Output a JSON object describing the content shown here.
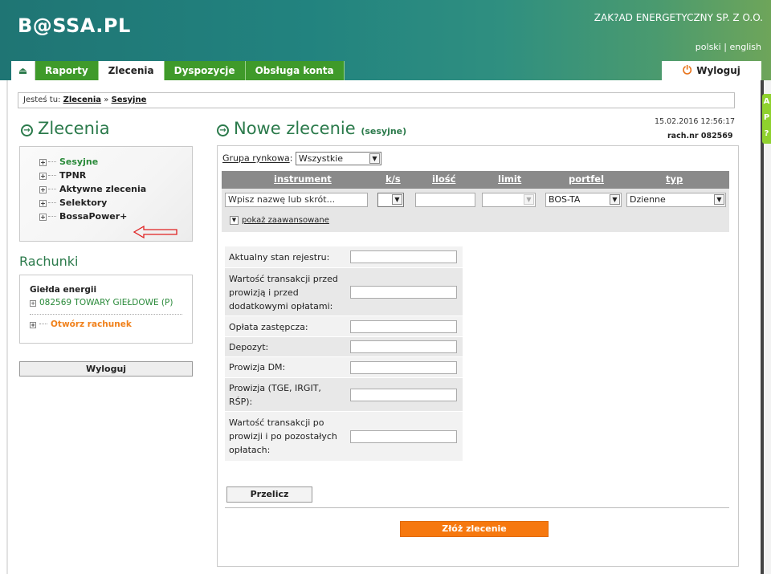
{
  "header": {
    "logo": "B@SSA.PL",
    "company": "ZAK?AD ENERGETYCZNY SP. Z O.O.",
    "lang_pl": "polski",
    "lang_sep": "|",
    "lang_en": "english",
    "logout": "Wyloguj"
  },
  "nav": {
    "tabs": [
      "Raporty",
      "Zlecenia",
      "Dyspozycje",
      "Obsługa konta"
    ],
    "active": "Zlecenia"
  },
  "side_badges": [
    "A",
    "P",
    "?"
  ],
  "breadcrumb": {
    "prefix": "Jesteś tu:",
    "items": [
      "Zlecenia",
      "Sesyjne"
    ],
    "sep": "»"
  },
  "left": {
    "title": "Zlecenia",
    "menu": [
      "Sesyjne",
      "TPNR",
      "Aktywne zlecenia",
      "Selektory",
      "BossaPower+"
    ],
    "accounts_title": "Rachunki",
    "group_label": "Giełda energii",
    "account": "082569 TOWARY GIEŁDOWE (P)",
    "open_account": "Otwórz rachunek",
    "logout": "Wyloguj"
  },
  "main": {
    "title": "Nowe zlecenie",
    "subtitle": "(sesyjne)",
    "datetime": "15.02.2016 12:56:17",
    "account_num": "rach.nr 082569",
    "group_label": "Grupa rynkowa",
    "group_value": "Wszystkie",
    "columns": [
      "instrument",
      "k/s",
      "ilość",
      "limit",
      "portfel",
      "typ"
    ],
    "instrument_placeholder": "Wpisz nazwę lub skrót...",
    "portfel_value": "BOS-TA",
    "typ_value": "Dzienne",
    "advanced": "pokaż zaawansowane",
    "calc_rows": [
      "Aktualny stan rejestru:",
      "Wartość transakcji przed prowizją i przed dodatkowymi opłatami:",
      "Opłata zastępcza:",
      "Depozyt:",
      "Prowizja DM:",
      "Prowizja (TGE, IRGIT, RŚP):",
      "Wartość transakcji po prowizji i po pozostałych opłatach:"
    ],
    "calc_button": "Przelicz",
    "submit_button": "Złóż zlecenie"
  }
}
